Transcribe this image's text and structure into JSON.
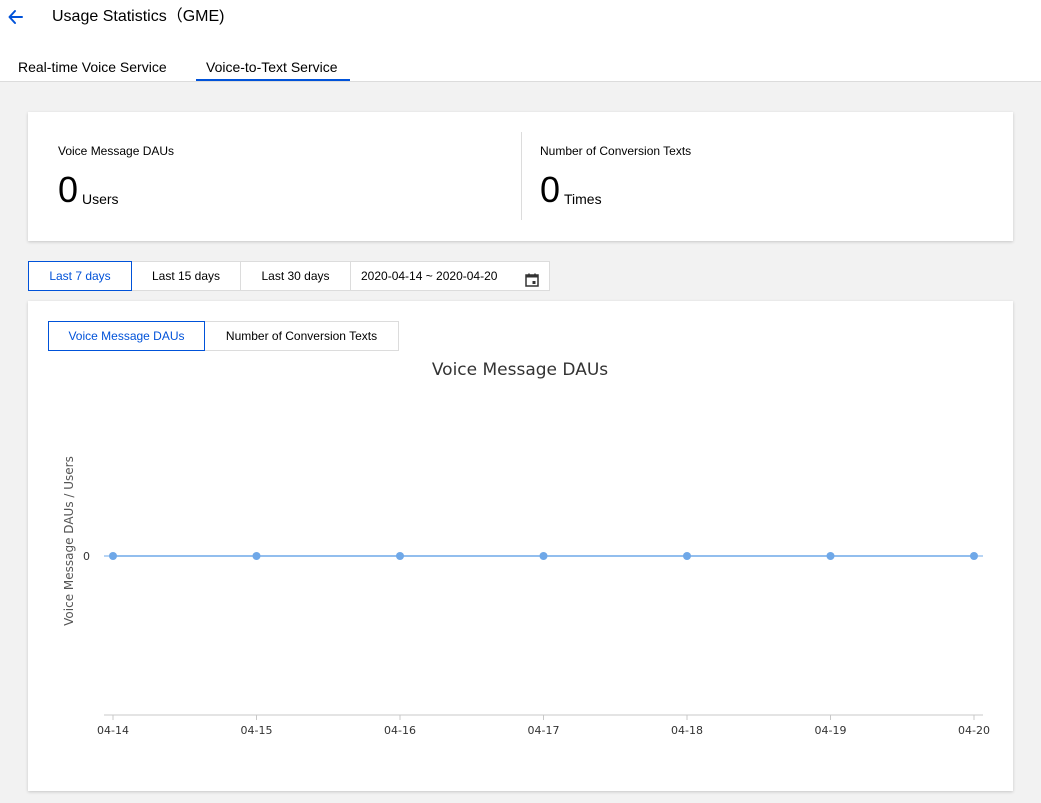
{
  "header": {
    "title": "Usage Statistics（GME)",
    "tabs": [
      {
        "label": "Real-time Voice Service",
        "active": false
      },
      {
        "label": "Voice-to-Text Service",
        "active": true
      }
    ]
  },
  "summary": {
    "dau": {
      "label": "Voice Message DAUs",
      "value": "0",
      "unit": "Users"
    },
    "conversions": {
      "label": "Number of Conversion Texts",
      "value": "0",
      "unit": "Times"
    }
  },
  "range": {
    "options": [
      "Last 7 days",
      "Last 15 days",
      "Last 30 days"
    ],
    "selected": "Last 7 days",
    "date_range": "2020-04-14 ~ 2020-04-20"
  },
  "chart_tabs": {
    "options": [
      "Voice Message DAUs",
      "Number of Conversion Texts"
    ],
    "selected": "Voice Message DAUs"
  },
  "colors": {
    "accent": "#0052d9",
    "series": "#6fa8e8"
  },
  "icons": {
    "back": "arrow-left-icon",
    "calendar": "calendar-icon"
  },
  "chart_data": {
    "type": "line",
    "title": "Voice Message DAUs",
    "ylabel": "Voice Message DAUs / Users",
    "xlabel": "",
    "categories": [
      "04-14",
      "04-15",
      "04-16",
      "04-17",
      "04-18",
      "04-19",
      "04-20"
    ],
    "series": [
      {
        "values": [
          0,
          0,
          0,
          0,
          0,
          0,
          0
        ]
      }
    ],
    "yticks": [
      "0"
    ],
    "grid": false
  }
}
